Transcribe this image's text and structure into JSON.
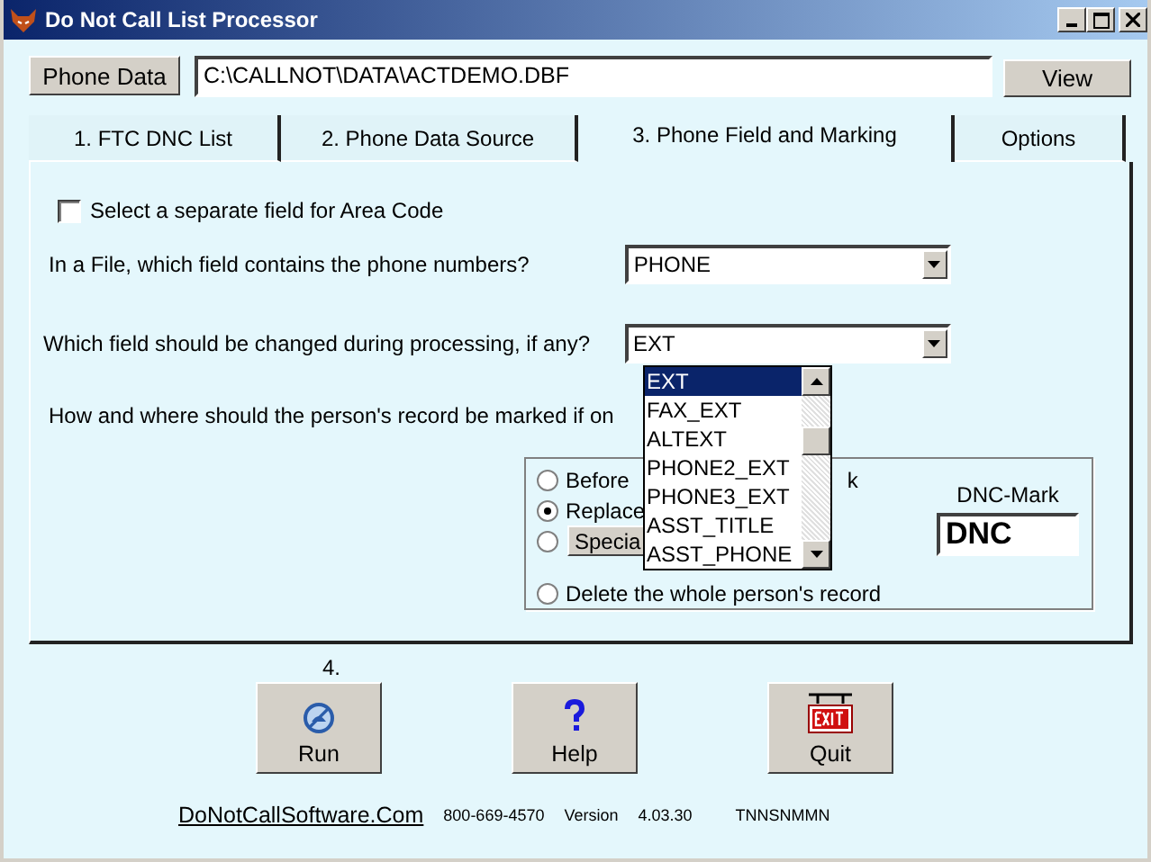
{
  "window": {
    "title": "Do Not Call List Processor"
  },
  "source": {
    "button": "Phone Data",
    "path": "C:\\CALLNOT\\DATA\\ACTDEMO.DBF",
    "view_button": "View"
  },
  "tabs": [
    {
      "label": "1. FTC DNC List",
      "selected": false
    },
    {
      "label": "2. Phone Data Source",
      "selected": false
    },
    {
      "label": "3. Phone Field and Marking",
      "selected": true
    },
    {
      "label": "Options",
      "selected": false
    }
  ],
  "area_code": {
    "label": "Select a separate field for Area Code",
    "checked": false
  },
  "phone_field": {
    "question": "In a File, which field contains the phone numbers?",
    "value": "PHONE"
  },
  "change_field": {
    "question": "Which field should be changed during processing, if any?",
    "value": "EXT",
    "options": [
      {
        "label": "EXT",
        "selected": true
      },
      {
        "label": "FAX_EXT",
        "selected": false
      },
      {
        "label": "ALTEXT",
        "selected": false
      },
      {
        "label": "PHONE2_EXT",
        "selected": false
      },
      {
        "label": "PHONE3_EXT",
        "selected": false
      },
      {
        "label": "ASST_TITLE",
        "selected": false
      },
      {
        "label": "ASST_PHONE",
        "selected": false
      }
    ]
  },
  "marking": {
    "question": "How and where should the person's  record be marked if on",
    "options": [
      {
        "kind": "text",
        "label": "Before",
        "tail": "k",
        "selected": false
      },
      {
        "kind": "text",
        "label": "Replace",
        "selected": true
      },
      {
        "kind": "button",
        "label": "Specia",
        "selected": false
      },
      {
        "kind": "text",
        "label": "Delete the whole person's record",
        "selected": false
      }
    ],
    "mark_label": "DNC-Mark",
    "mark_value": "DNC"
  },
  "step_label": "4.",
  "buttons": [
    {
      "kind": "run",
      "label": "Run"
    },
    {
      "kind": "help",
      "label": "Help"
    },
    {
      "kind": "quit",
      "label": "Quit"
    }
  ],
  "footer": {
    "link": "DoNotCallSoftware.Com",
    "phone": "800-669-4570",
    "version_label": "Version",
    "version": "4.03.30",
    "code": "TNNSNMMN"
  }
}
